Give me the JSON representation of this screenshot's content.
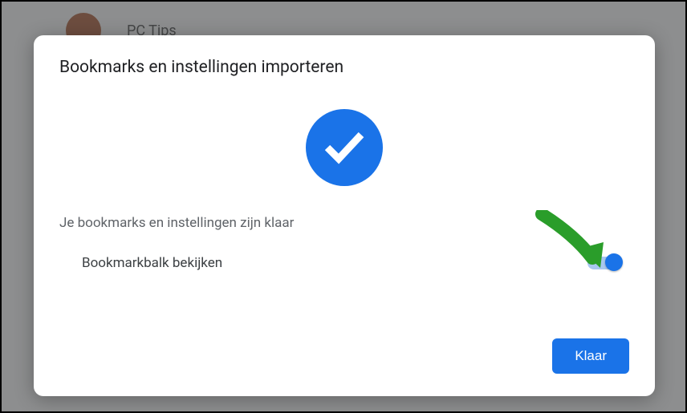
{
  "backdrop": {
    "profile_name": "PC Tips"
  },
  "dialog": {
    "title": "Bookmarks en instellingen importeren",
    "status_text": "Je bookmarks en instellingen zijn klaar",
    "toggle_label": "Bookmarkbalk bekijken",
    "toggle_on": true,
    "done_label": "Klaar"
  },
  "colors": {
    "accent": "#1a73e8",
    "text_primary": "#202124",
    "text_secondary": "#5f6368",
    "arrow": "#2a9d2a"
  }
}
